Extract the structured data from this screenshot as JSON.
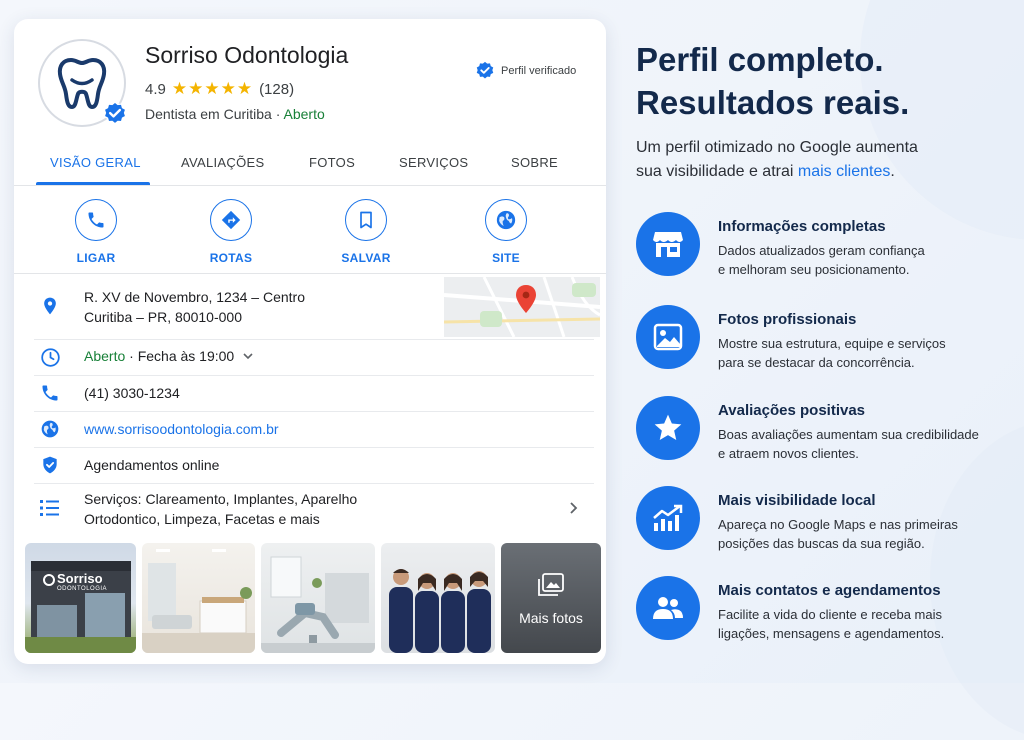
{
  "business": {
    "name": "Sorriso Odontologia",
    "rating": "4.9",
    "stars": "★★★★★",
    "reviews_count": "(128)",
    "category": "Dentista em Curitiba",
    "separator": " · ",
    "status": "Aberto",
    "verified_label": "Perfil verificado"
  },
  "tabs": [
    {
      "label": "VISÃO GERAL"
    },
    {
      "label": "AVALIAÇÕES"
    },
    {
      "label": "FOTOS"
    },
    {
      "label": "SERVIÇOS"
    },
    {
      "label": "SOBRE"
    }
  ],
  "actions": [
    {
      "label": "LIGAR",
      "icon": "phone-icon"
    },
    {
      "label": "ROTAS",
      "icon": "directions-icon"
    },
    {
      "label": "SALVAR",
      "icon": "bookmark-icon"
    },
    {
      "label": "SITE",
      "icon": "globe-icon"
    }
  ],
  "info": {
    "address_line1": "R. XV de Novembro, 1234 – Centro",
    "address_line2": "Curitiba – PR, 80010-000",
    "hours_status": "Aberto",
    "hours_detail": "· Fecha às 19:00",
    "phone": "(41) 3030-1234",
    "website": "www.sorrisoodontologia.com.br",
    "booking": "Agendamentos online",
    "services_label": "Serviços:",
    "services_line1": "Clareamento, Implantes, Aparelho",
    "services_line2": "Ortodontico, Limpeza, Facetas e mais"
  },
  "photos": {
    "facade_sign_line1": "Sorriso",
    "facade_sign_line2": "ODONTOLOGIA",
    "more_label": "Mais fotos"
  },
  "marketing": {
    "headline_line1": "Perfil completo.",
    "headline_line2": "Resultados reais.",
    "subtitle_line1": "Um perfil otimizado no Google aumenta",
    "subtitle_line2": "sua visibilidade e atrai ",
    "subtitle_highlight": "mais clientes",
    "subtitle_end": ".",
    "features": [
      {
        "title": "Informações completas",
        "line1": "Dados atualizados geram confiança",
        "line2": "e melhoram seu posicionamento.",
        "icon": "storefront-icon"
      },
      {
        "title": "Fotos profissionais",
        "line1": "Mostre sua estrutura, equipe e serviços",
        "line2": "para se destacar da concorrência.",
        "icon": "image-icon"
      },
      {
        "title": "Avaliações positivas",
        "line1": "Boas avaliações aumentam sua credibilidade",
        "line2": "e atraem novos clientes.",
        "icon": "star-icon"
      },
      {
        "title": "Mais visibilidade local",
        "line1": "Apareça no Google Maps e nas primeiras",
        "line2": "posições das buscas da sua região.",
        "icon": "trending-up-icon"
      },
      {
        "title": "Mais contatos e agendamentos",
        "line1": "Facilite a vida do cliente e receba mais",
        "line2": "ligações, mensagens e agendamentos.",
        "icon": "people-icon"
      }
    ]
  },
  "colors": {
    "accent": "#1a73e8",
    "open_green": "#188038",
    "star_gold": "#f4b400",
    "navy": "#13294b"
  }
}
